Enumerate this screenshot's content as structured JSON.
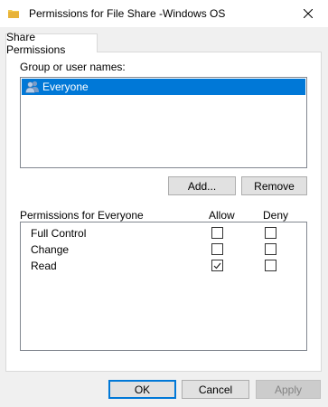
{
  "window": {
    "title": "Permissions for File Share -Windows OS"
  },
  "tabs": [
    {
      "label": "Share Permissions",
      "selected": true
    }
  ],
  "group": {
    "label": "Group or user names:",
    "items": [
      {
        "name": "Everyone",
        "icon": "users-icon",
        "selected": true
      }
    ]
  },
  "buttons": {
    "add": "Add...",
    "remove": "Remove",
    "ok": "OK",
    "cancel": "Cancel",
    "apply": "Apply"
  },
  "permissions": {
    "header": "Permissions for Everyone",
    "allow_label": "Allow",
    "deny_label": "Deny",
    "rows": [
      {
        "name": "Full Control",
        "allow": false,
        "deny": false
      },
      {
        "name": "Change",
        "allow": false,
        "deny": false
      },
      {
        "name": "Read",
        "allow": true,
        "deny": false
      }
    ]
  },
  "colors": {
    "selection": "#0078d7",
    "dialog_bg": "#f0f0f0",
    "folder_icon": "#f2c94c"
  }
}
